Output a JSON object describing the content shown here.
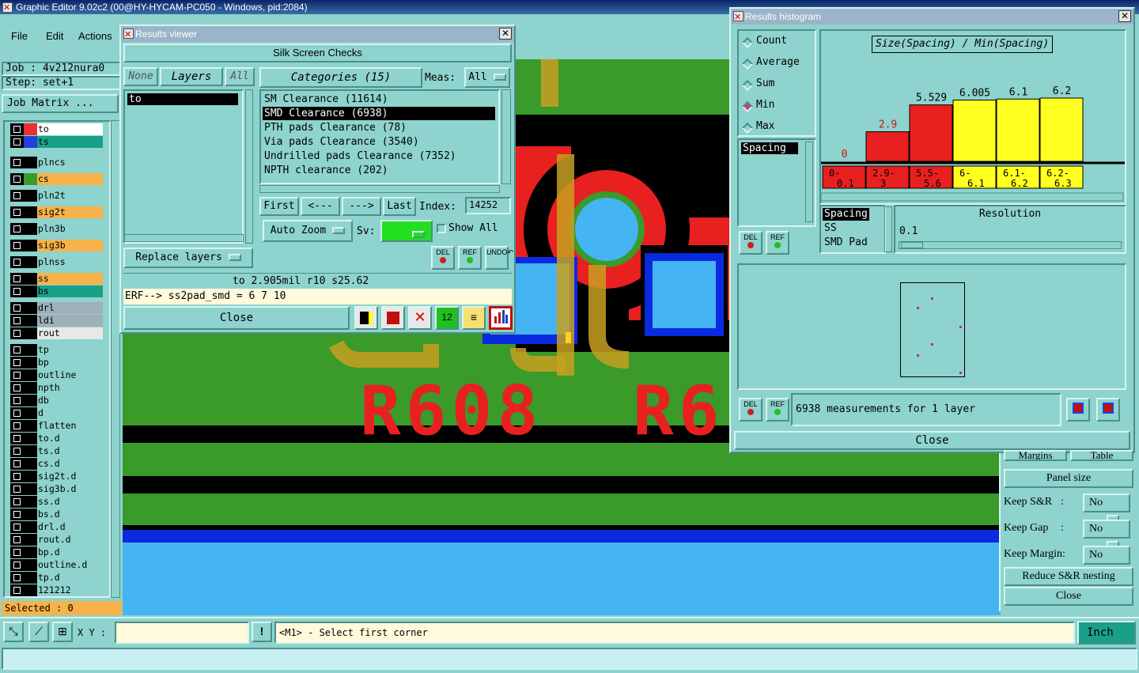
{
  "app": {
    "title": "Graphic Editor 9.02c2 (00@HY-HYCAM-PC050 - Windows, pid:2084)"
  },
  "menu": {
    "file": "File",
    "edit": "Edit",
    "actions": "Actions"
  },
  "job": {
    "label": "Job : 4v212nura0",
    "step": "Step: set+1",
    "matrix_btn": "Job Matrix ..."
  },
  "layers": [
    {
      "name": "to",
      "color": "#e83030",
      "row": "#ffffff"
    },
    {
      "name": "ts",
      "color": "#2040e0",
      "row": "#1aa088"
    },
    {
      "name": "plncs",
      "color": "#000000",
      "row": "#8ed3cd"
    },
    {
      "name": "cs",
      "color": "#3a9a2a",
      "row": "#f7b24a"
    },
    {
      "name": "pln2t",
      "color": "#000000",
      "row": "#8ed3cd"
    },
    {
      "name": "sig2t",
      "color": "#000000",
      "row": "#f7b24a"
    },
    {
      "name": "pln3b",
      "color": "#000000",
      "row": "#8ed3cd"
    },
    {
      "name": "sig3b",
      "color": "#000000",
      "row": "#f7b24a"
    },
    {
      "name": "plnss",
      "color": "#000000",
      "row": "#8ed3cd"
    },
    {
      "name": "ss",
      "color": "#000000",
      "row": "#f7b24a"
    },
    {
      "name": "bs",
      "color": "#000000",
      "row": "#1aa088"
    },
    {
      "name": "drl",
      "color": "#000000",
      "row": "#a0b0b8"
    },
    {
      "name": "ldi",
      "color": "#000000",
      "row": "#a0b0b8"
    },
    {
      "name": "rout",
      "color": "#000000",
      "row": "#e8e8e8"
    },
    {
      "name": "tp",
      "color": "#000000",
      "row": "#8ed3cd"
    },
    {
      "name": "bp",
      "color": "#000000",
      "row": "#8ed3cd"
    },
    {
      "name": "outline",
      "color": "#000000",
      "row": "#8ed3cd"
    },
    {
      "name": "npth",
      "color": "#000000",
      "row": "#8ed3cd"
    },
    {
      "name": "db",
      "color": "#000000",
      "row": "#8ed3cd"
    },
    {
      "name": "d",
      "color": "#000000",
      "row": "#8ed3cd"
    },
    {
      "name": "flatten",
      "color": "#000000",
      "row": "#8ed3cd"
    },
    {
      "name": "to.d",
      "color": "#000000",
      "row": "#8ed3cd"
    },
    {
      "name": "ts.d",
      "color": "#000000",
      "row": "#8ed3cd"
    },
    {
      "name": "cs.d",
      "color": "#000000",
      "row": "#8ed3cd"
    },
    {
      "name": "sig2t.d",
      "color": "#000000",
      "row": "#8ed3cd"
    },
    {
      "name": "sig3b.d",
      "color": "#000000",
      "row": "#8ed3cd"
    },
    {
      "name": "ss.d",
      "color": "#000000",
      "row": "#8ed3cd"
    },
    {
      "name": "bs.d",
      "color": "#000000",
      "row": "#8ed3cd"
    },
    {
      "name": "drl.d",
      "color": "#000000",
      "row": "#8ed3cd"
    },
    {
      "name": "rout.d",
      "color": "#000000",
      "row": "#8ed3cd"
    },
    {
      "name": "bp.d",
      "color": "#000000",
      "row": "#8ed3cd"
    },
    {
      "name": "outline.d",
      "color": "#000000",
      "row": "#8ed3cd"
    },
    {
      "name": "tp.d",
      "color": "#000000",
      "row": "#8ed3cd"
    },
    {
      "name": "121212",
      "color": "#000000",
      "row": "#8ed3cd"
    }
  ],
  "selected": "Selected : 0",
  "canvas": {
    "ref1": "R608",
    "ref2": "R6"
  },
  "results_viewer": {
    "title": "Results viewer",
    "header": "Silk Screen Checks",
    "none": "None",
    "layers": "Layers",
    "all": "All",
    "categories_btn": "Categories (15)",
    "meas_label": "Meas:",
    "meas_value": "All",
    "layer_list": [
      "to"
    ],
    "categories": [
      "SM Clearance (11614)",
      "SMD Clearance (6938)",
      "PTH pads Clearance (78)",
      "Via pads Clearance (3540)",
      "Undrilled pads Clearance (7352)",
      "NPTH clearance (202)"
    ],
    "first": "First",
    "prev": "<---",
    "next": "--->",
    "last": "Last",
    "index_label": "Index:",
    "index_value": "14252",
    "auto_zoom": "Auto Zoom",
    "sv_label": "Sv:",
    "show_all": "Show All",
    "replace_layers": "Replace layers",
    "del": "DEL",
    "ref": "REF",
    "undo": "UNDO",
    "status1": "to 2.905mil  r10  s25.62",
    "status2": "ERF--> ss2pad_smd = 6 7 10",
    "close": "Close"
  },
  "histogram": {
    "title": "Results histogram",
    "modes": [
      "Count",
      "Average",
      "Sum",
      "Min",
      "Max"
    ],
    "selected_mode": "Min",
    "chart_title": "Size(Spacing) / Min(Spacing)",
    "measure_list": [
      "Spacing"
    ],
    "type_list": [
      "Spacing",
      "SS",
      "SMD Pad"
    ],
    "resolution_label": "Resolution",
    "resolution_value": "0.1",
    "summary": "6938 measurements for 1 layer",
    "close": "Close",
    "del": "DEL",
    "ref": "REF"
  },
  "chart_data": {
    "type": "bar",
    "title": "Size(Spacing) / Min(Spacing)",
    "categories": [
      "0-\n0.1",
      "2.9-\n3",
      "5.5-\n5.6",
      "6-\n6.1",
      "6.1-\n6.2",
      "6.2-\n6.3"
    ],
    "values": [
      0,
      2.9,
      5.529,
      6.005,
      6.1,
      6.2
    ],
    "value_labels": [
      "0",
      "2.9",
      "5.529",
      "6.005",
      "6.1",
      "6.2"
    ],
    "colors": [
      "#e82020",
      "#e82020",
      "#e82020",
      "#ffff20",
      "#ffff20",
      "#ffff20"
    ]
  },
  "right_panel": {
    "margins": "Margins",
    "table": "Table",
    "panel_size": "Panel size",
    "keep_sr": "Keep S&R",
    "keep_gap": "Keep Gap",
    "keep_margin": "Keep Margin:",
    "colon": ":",
    "no": "No",
    "reduce": "Reduce S&R nesting",
    "close": "Close"
  },
  "bottom": {
    "xy_label": "X Y :",
    "xy_value": "",
    "excl": "!",
    "prompt": "<M1> - Select first corner",
    "units": "Inch"
  }
}
